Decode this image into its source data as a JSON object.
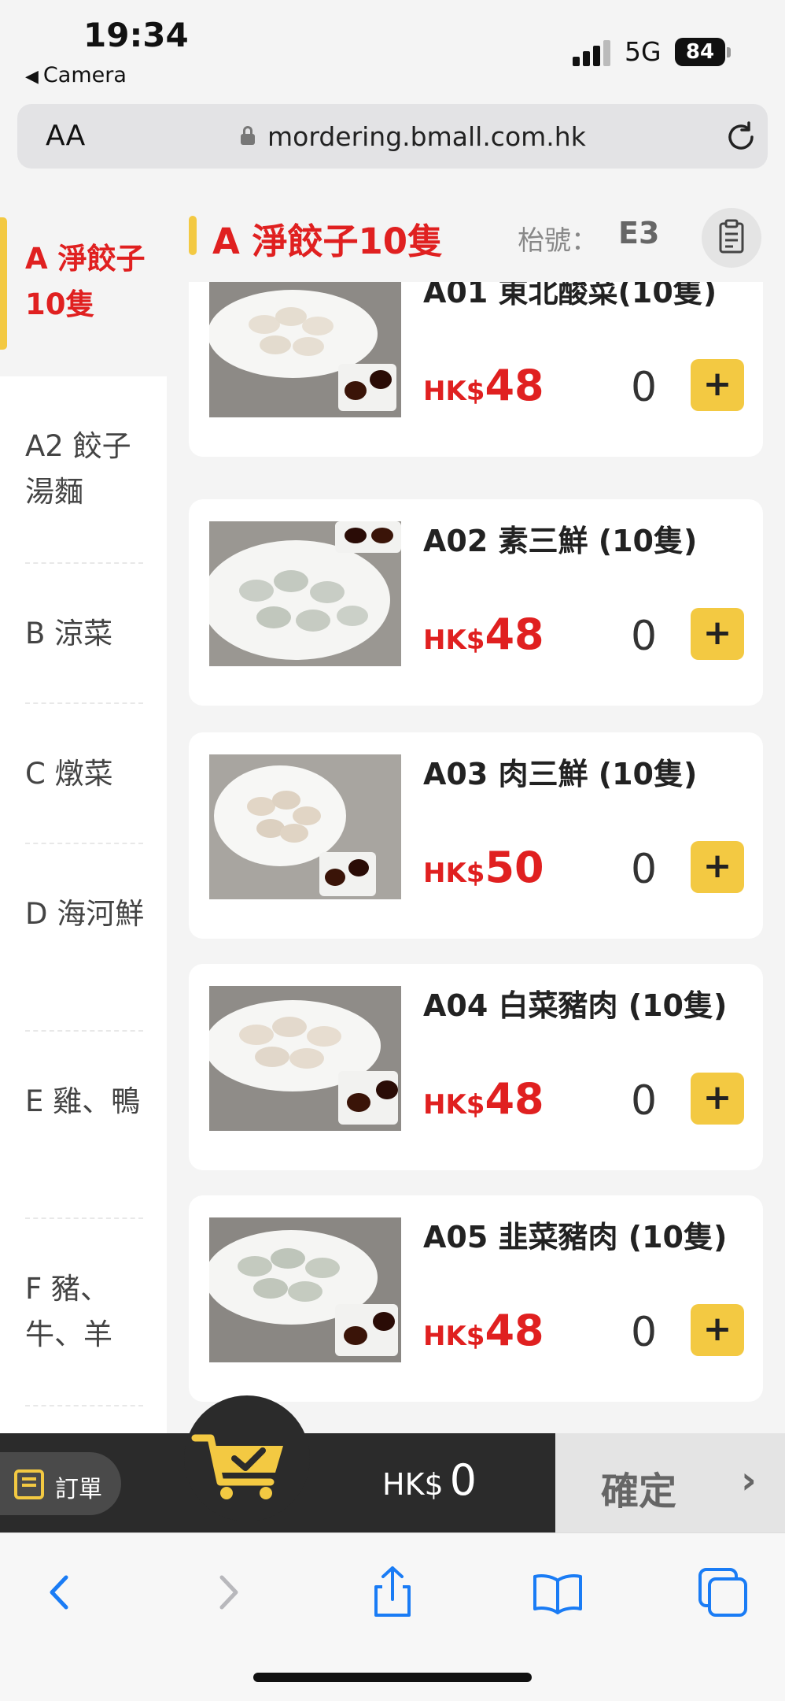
{
  "status_bar": {
    "time": "19:34",
    "back_app": "Camera",
    "network": "5G",
    "battery": "84"
  },
  "browser": {
    "text_size_label": "AA",
    "url": "mordering.bmall.com.hk"
  },
  "sidebar": {
    "items": [
      {
        "label": "A 淨餃子10隻",
        "active": true
      },
      {
        "label": "A2 餃子湯麵",
        "active": false
      },
      {
        "label": "B 涼菜",
        "active": false
      },
      {
        "label": "C 燉菜",
        "active": false
      },
      {
        "label": "D 海河鮮",
        "active": false
      },
      {
        "label": "E 雞、鴨",
        "active": false
      },
      {
        "label": "F 豬、牛、羊",
        "active": false
      }
    ]
  },
  "header": {
    "category_title": "A 淨餃子10隻",
    "table_label": "枱號：",
    "table_number": "E3"
  },
  "products": [
    {
      "name": "A01 東北酸菜(10隻)",
      "currency": "HK$",
      "price": "48",
      "quantity": "0",
      "add_label": "+"
    },
    {
      "name": "A02 素三鮮 (10隻)",
      "currency": "HK$",
      "price": "48",
      "quantity": "0",
      "add_label": "+"
    },
    {
      "name": "A03 肉三鮮 (10隻)",
      "currency": "HK$",
      "price": "50",
      "quantity": "0",
      "add_label": "+"
    },
    {
      "name": "A04 白菜豬肉 (10隻)",
      "currency": "HK$",
      "price": "48",
      "quantity": "0",
      "add_label": "+"
    },
    {
      "name": "A05 韭菜豬肉 (10隻)",
      "currency": "HK$",
      "price": "48",
      "quantity": "0",
      "add_label": "+"
    }
  ],
  "cart": {
    "orders_label": "訂單",
    "currency": "HK$",
    "total": "0",
    "confirm_label": "確定",
    "confirm_chevron": "›"
  },
  "colors": {
    "accent_yellow": "#f3c942",
    "price_red": "#e02020",
    "cart_bar": "#2b2b2b",
    "safari_blue": "#1a7cf5"
  },
  "icons": {
    "reload": "reload-icon",
    "lock": "lock-icon",
    "clipboard": "clipboard-icon",
    "cart": "cart-check-icon",
    "back": "back-chevron-icon",
    "forward": "forward-chevron-icon",
    "share": "share-icon",
    "bookmarks": "bookmarks-icon",
    "tabs": "tabs-icon"
  }
}
